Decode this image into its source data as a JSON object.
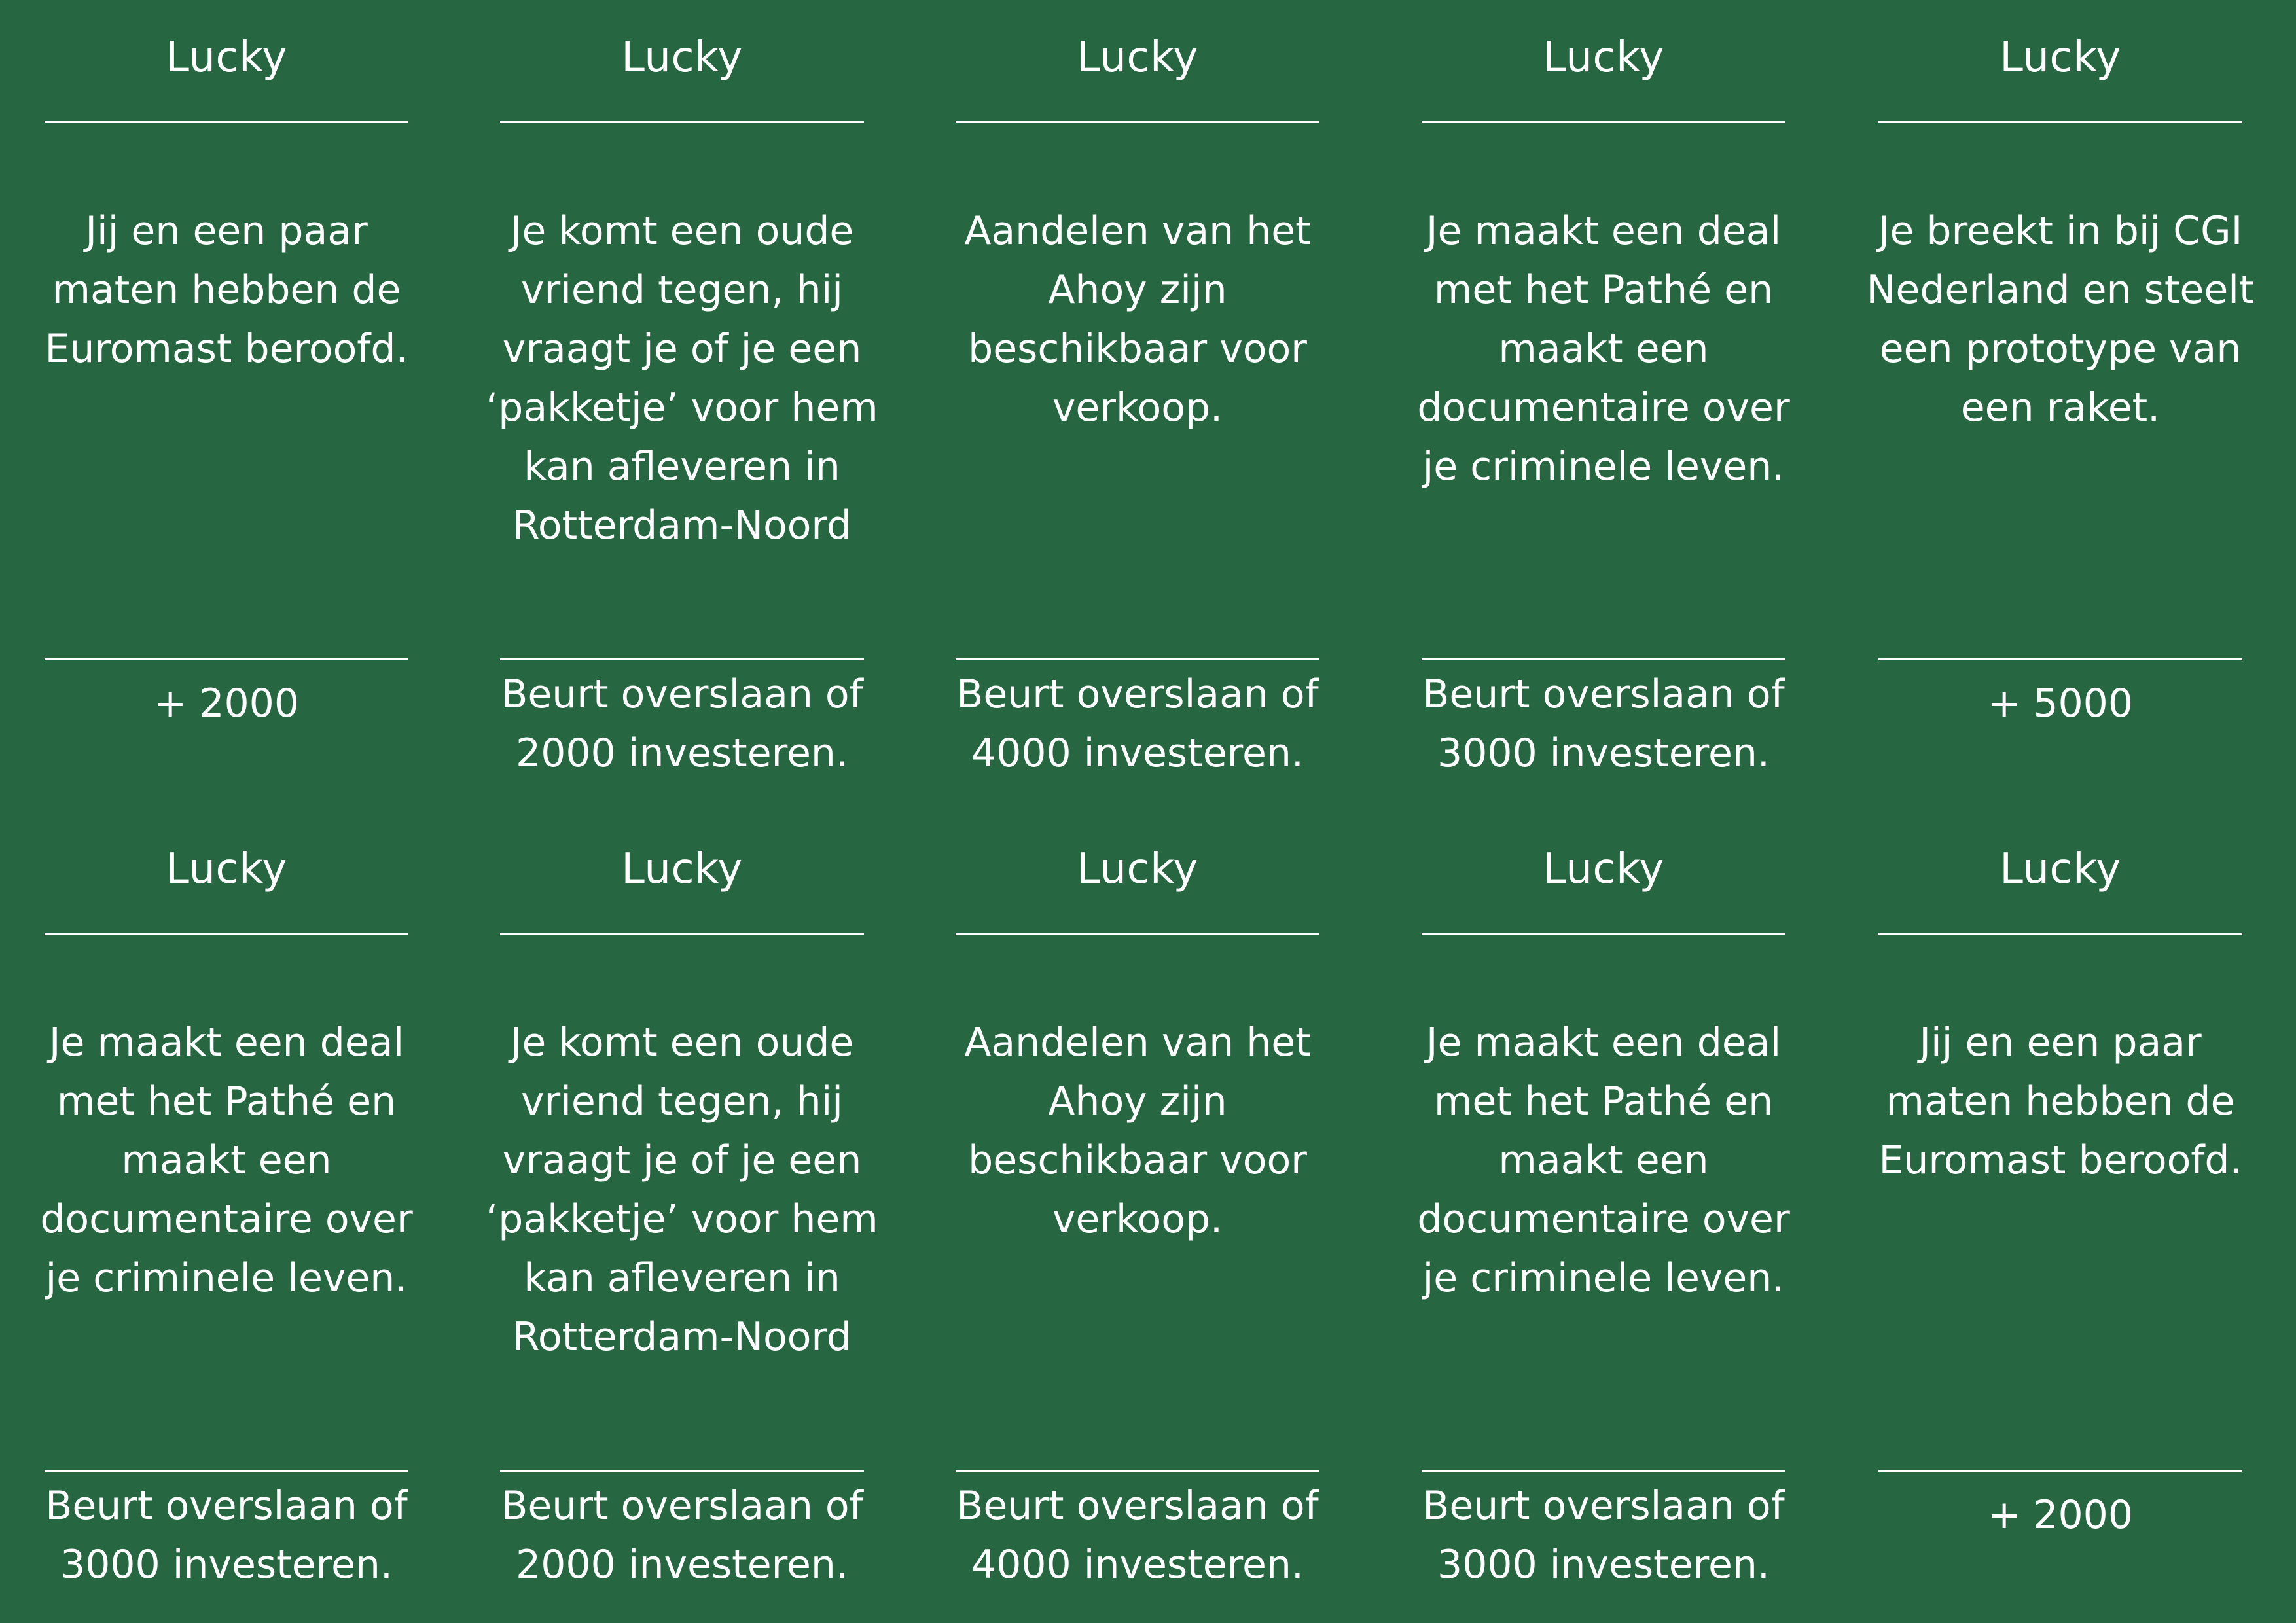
{
  "sheet": {
    "background_color": "#266741",
    "text_color": "#ffffff"
  },
  "cards": [
    {
      "title": "Lucky",
      "body_lines": [
        "Jij en een paar",
        "maten hebben de",
        "Euromast beroofd."
      ],
      "footer_lines": [
        "+ 2000"
      ]
    },
    {
      "title": "Lucky",
      "body_lines": [
        "Je komt een oude",
        "vriend tegen, hij",
        "vraagt je of je een",
        "‘pakketje’ voor hem",
        "kan afleveren in",
        "Rotterdam-Noord"
      ],
      "footer_lines": [
        "Beurt overslaan of",
        "2000 investeren."
      ]
    },
    {
      "title": "Lucky",
      "body_lines": [
        "Aandelen van het",
        "Ahoy zijn",
        "beschikbaar voor",
        "verkoop."
      ],
      "footer_lines": [
        "Beurt overslaan of",
        "4000 investeren."
      ]
    },
    {
      "title": "Lucky",
      "body_lines": [
        "Je maakt een deal",
        "met het Pathé en",
        "maakt een",
        "documentaire over",
        "je criminele leven."
      ],
      "footer_lines": [
        "Beurt overslaan of",
        "3000 investeren."
      ]
    },
    {
      "title": "Lucky",
      "body_lines": [
        "Je breekt in bij CGI",
        "Nederland en steelt",
        "een prototype van",
        "een raket."
      ],
      "footer_lines": [
        "+ 5000"
      ]
    },
    {
      "title": "Lucky",
      "body_lines": [
        "Je maakt een deal",
        "met het Pathé en",
        "maakt een",
        "documentaire over",
        "je criminele leven."
      ],
      "footer_lines": [
        "Beurt overslaan of",
        "3000 investeren."
      ]
    },
    {
      "title": "Lucky",
      "body_lines": [
        "Je komt een oude",
        "vriend tegen, hij",
        "vraagt je of je een",
        "‘pakketje’ voor hem",
        "kan afleveren in",
        "Rotterdam-Noord"
      ],
      "footer_lines": [
        "Beurt overslaan of",
        "2000 investeren."
      ]
    },
    {
      "title": "Lucky",
      "body_lines": [
        "Aandelen van het",
        "Ahoy zijn",
        "beschikbaar voor",
        "verkoop."
      ],
      "footer_lines": [
        "Beurt overslaan of",
        "4000 investeren."
      ]
    },
    {
      "title": "Lucky",
      "body_lines": [
        "Je maakt een deal",
        "met het Pathé en",
        "maakt een",
        "documentaire over",
        "je criminele leven."
      ],
      "footer_lines": [
        "Beurt overslaan of",
        "3000 investeren."
      ]
    },
    {
      "title": "Lucky",
      "body_lines": [
        "Jij en een paar",
        "maten hebben de",
        "Euromast beroofd."
      ],
      "footer_lines": [
        "+ 2000"
      ]
    }
  ]
}
